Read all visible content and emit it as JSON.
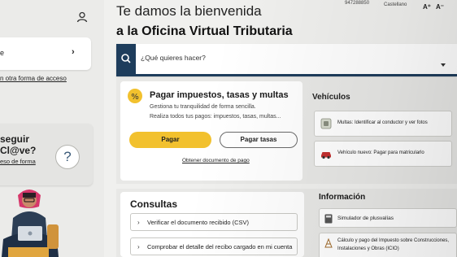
{
  "topbar": {
    "phone": "947288850",
    "language": "Castellano",
    "font_increase": "A⁺",
    "font_decrease": "A⁻"
  },
  "sidebar": {
    "access_row_text": "e",
    "other_access_text": "n otra forma de acceso",
    "clave_line1": "seguir",
    "clave_line2": "Cl@ve?",
    "clave_link": "eso de forma",
    "help_symbol": "?"
  },
  "welcome": {
    "line1": "Te damos la bienvenida",
    "line2": "a la Oficina Virtual Tributaria"
  },
  "search": {
    "placeholder": "¿Qué quieres hacer?"
  },
  "pay": {
    "title": "Pagar impuestos, tasas y multas",
    "desc_line1": "Gestiona tu tranquilidad de forma sencilla.",
    "desc_line2": "Realiza todos tus pagos: impuestos, tasas, multas...",
    "pay_button": "Pagar",
    "fees_button": "Pagar tasas",
    "document_link": "Obtener documento de pago"
  },
  "vehicles": {
    "title": "Vehículos",
    "items": [
      {
        "label": "Multas: Identificar al conductor y ver fotos"
      },
      {
        "label": "Vehículo nuevo: Pagar para matricularlo"
      }
    ]
  },
  "consultas": {
    "title": "Consultas",
    "items": [
      {
        "label": "Verificar el documento recibido (CSV)"
      },
      {
        "label": "Comprobar el detalle del recibo cargado en mi cuenta"
      }
    ]
  },
  "info": {
    "title": "Información",
    "item1": "Simulador de plusvalías",
    "item2_line1": "Cálculo y pago del Impuesto sobre Construcciones,",
    "item2_line2": "Instalaciones y Obras (ICIO)"
  },
  "colors": {
    "accent_yellow": "#f2c12e",
    "navy": "#1e3d5c",
    "background": "#f0f0ee"
  }
}
